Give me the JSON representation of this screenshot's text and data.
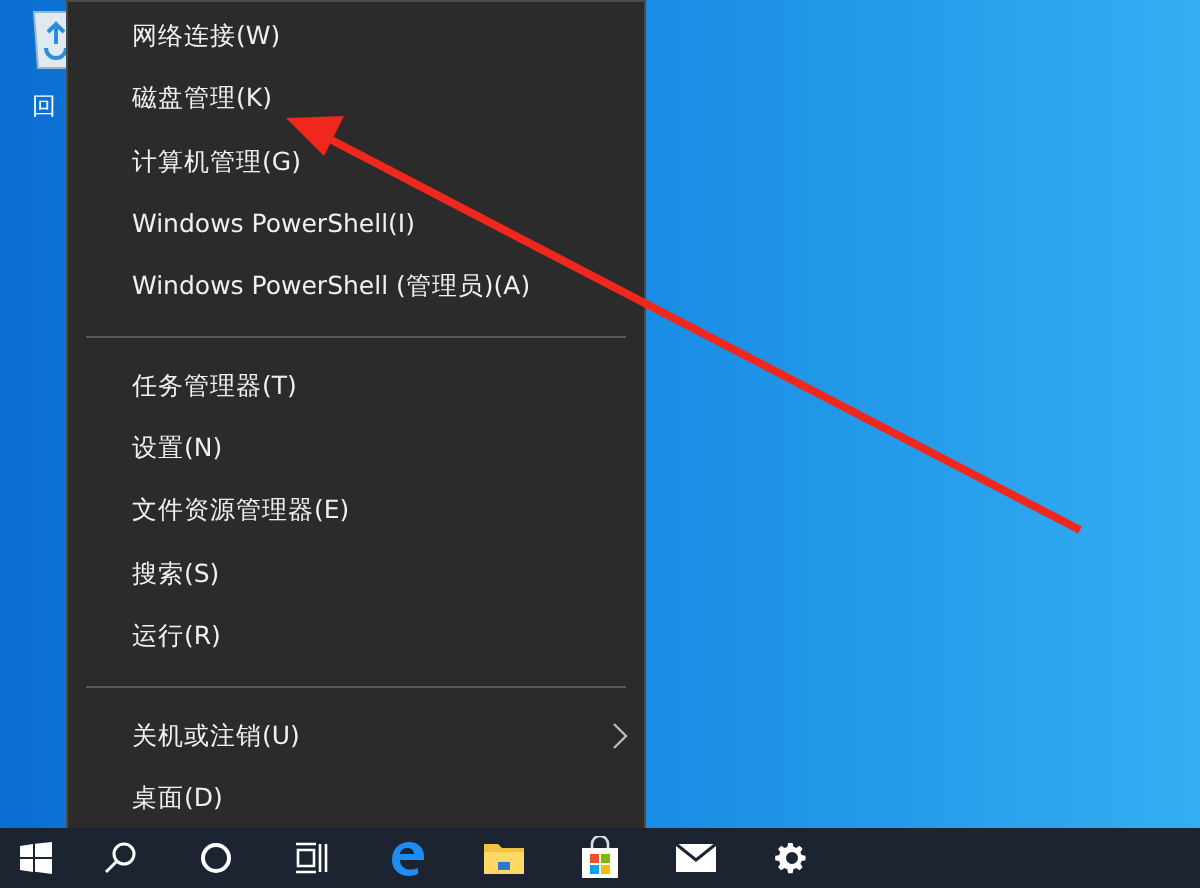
{
  "desktop": {
    "icons": [
      {
        "label": "回"
      }
    ]
  },
  "context_menu": {
    "items": [
      {
        "kind": "item",
        "label": "网络连接(W)"
      },
      {
        "kind": "item",
        "label": "磁盘管理(K)"
      },
      {
        "kind": "item",
        "label": "计算机管理(G)"
      },
      {
        "kind": "item",
        "label": "Windows PowerShell(I)"
      },
      {
        "kind": "item",
        "label": "Windows PowerShell (管理员)(A)"
      },
      {
        "kind": "separator"
      },
      {
        "kind": "item",
        "label": "任务管理器(T)"
      },
      {
        "kind": "item",
        "label": "设置(N)"
      },
      {
        "kind": "item",
        "label": "文件资源管理器(E)"
      },
      {
        "kind": "item",
        "label": "搜索(S)"
      },
      {
        "kind": "item",
        "label": "运行(R)"
      },
      {
        "kind": "separator"
      },
      {
        "kind": "submenu",
        "label": "关机或注销(U)"
      },
      {
        "kind": "item",
        "label": "桌面(D)"
      }
    ]
  },
  "taskbar": {
    "icons": [
      {
        "kind": "start"
      },
      {
        "kind": "search"
      },
      {
        "kind": "cortana"
      },
      {
        "kind": "taskview"
      },
      {
        "kind": "edge"
      },
      {
        "kind": "explorer"
      },
      {
        "kind": "store"
      },
      {
        "kind": "mail"
      },
      {
        "kind": "settings"
      }
    ]
  }
}
